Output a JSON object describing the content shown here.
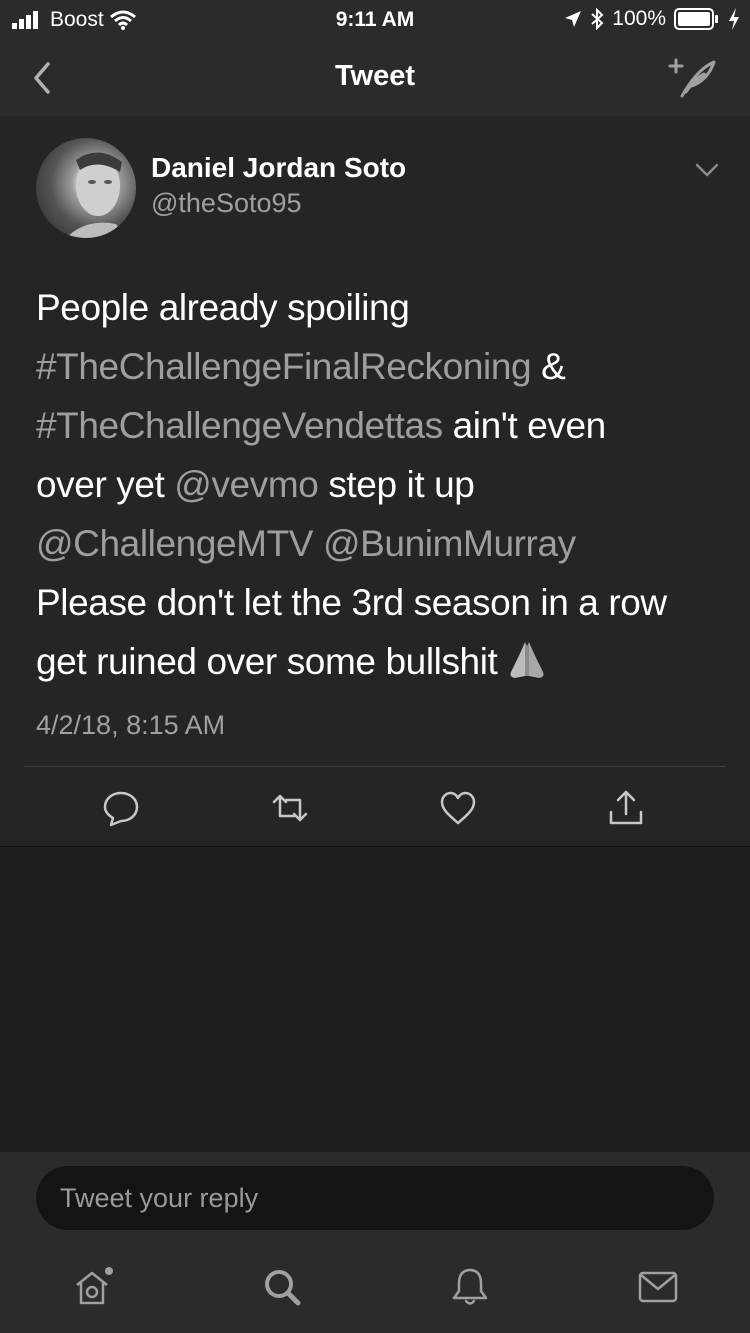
{
  "status_bar": {
    "carrier": "Boost",
    "time": "9:11 AM",
    "battery": "100%"
  },
  "nav": {
    "title": "Tweet"
  },
  "tweet": {
    "author_name": "Daniel Jordan Soto",
    "author_handle": "@theSoto95",
    "text": {
      "t1": "People already spoiling",
      "h1": "#TheChallengeFinalReckoning",
      "t2": " &",
      "h2": "#TheChallengeVendettas",
      "t3": " ain't even",
      "t4": "over yet ",
      "m1": "@vevmo",
      "t5": " step it up",
      "m2": "@ChallengeMTV",
      "t6": " ",
      "m3": "@BunimMurray",
      "t7": "Please don't let the 3rd season in a row",
      "t8": "get ruined over some bullshit"
    },
    "timestamp": "4/2/18, 8:15 AM"
  },
  "reply": {
    "placeholder": "Tweet your reply"
  },
  "colors": {
    "background": "#1e1e1e",
    "bar": "#2b2b2b",
    "card": "#252525",
    "link": "#9e9e9e",
    "secondary_text": "#a0a0a0"
  }
}
